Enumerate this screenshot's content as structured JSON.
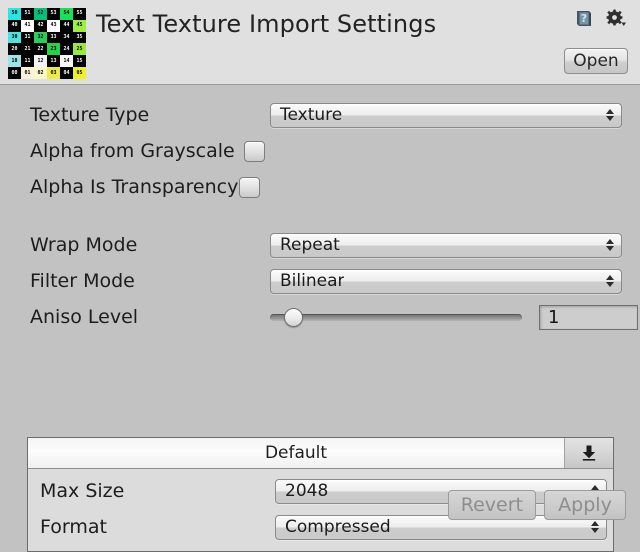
{
  "header": {
    "title": "Text Texture Import Settings",
    "help_icon": "help-book-icon",
    "gear_icon": "gear-icon",
    "open_label": "Open"
  },
  "texture_preview": {
    "name": "texture-thumbnail",
    "cells": [
      {
        "label": "50",
        "bg": "#26e6e6",
        "fg": "#000000"
      },
      {
        "label": "51",
        "bg": "#000000",
        "fg": "#ffffff"
      },
      {
        "label": "52",
        "bg": "#00c07a",
        "fg": "#000000"
      },
      {
        "label": "53",
        "bg": "#000000",
        "fg": "#ffffff"
      },
      {
        "label": "54",
        "bg": "#18e05a",
        "fg": "#000000"
      },
      {
        "label": "55",
        "bg": "#000000",
        "fg": "#ffffff"
      },
      {
        "label": "40",
        "bg": "#000000",
        "fg": "#ffffff"
      },
      {
        "label": "41",
        "bg": "#ffffff",
        "fg": "#000000"
      },
      {
        "label": "42",
        "bg": "#000000",
        "fg": "#ffffff"
      },
      {
        "label": "43",
        "bg": "#ffffff",
        "fg": "#000000"
      },
      {
        "label": "44",
        "bg": "#000000",
        "fg": "#ffffff"
      },
      {
        "label": "45",
        "bg": "#9cf03c",
        "fg": "#000000"
      },
      {
        "label": "30",
        "bg": "#4ae2e2",
        "fg": "#000000"
      },
      {
        "label": "31",
        "bg": "#000000",
        "fg": "#ffffff"
      },
      {
        "label": "32",
        "bg": "#28cf5e",
        "fg": "#000000"
      },
      {
        "label": "33",
        "bg": "#000000",
        "fg": "#ffffff"
      },
      {
        "label": "34",
        "bg": "#000000",
        "fg": "#ffffff"
      },
      {
        "label": "35",
        "bg": "#000000",
        "fg": "#ffffff"
      },
      {
        "label": "20",
        "bg": "#000000",
        "fg": "#ffffff"
      },
      {
        "label": "21",
        "bg": "#000000",
        "fg": "#ffffff"
      },
      {
        "label": "22",
        "bg": "#000000",
        "fg": "#ffffff"
      },
      {
        "label": "23",
        "bg": "#28d24a",
        "fg": "#000000"
      },
      {
        "label": "24",
        "bg": "#000000",
        "fg": "#ffffff"
      },
      {
        "label": "25",
        "bg": "#9ae83a",
        "fg": "#000000"
      },
      {
        "label": "10",
        "bg": "#9ae4ea",
        "fg": "#000000"
      },
      {
        "label": "11",
        "bg": "#000000",
        "fg": "#ffffff"
      },
      {
        "label": "12",
        "bg": "#f4f4f4",
        "fg": "#000000"
      },
      {
        "label": "13",
        "bg": "#000000",
        "fg": "#ffffff"
      },
      {
        "label": "14",
        "bg": "#f8f8f8",
        "fg": "#000000"
      },
      {
        "label": "15",
        "bg": "#000000",
        "fg": "#ffffff"
      },
      {
        "label": "00",
        "bg": "#000000",
        "fg": "#ffffff"
      },
      {
        "label": "01",
        "bg": "#f6f3d8",
        "fg": "#000000"
      },
      {
        "label": "02",
        "bg": "#faf7c8",
        "fg": "#000000"
      },
      {
        "label": "03",
        "bg": "#eeea46",
        "fg": "#000000"
      },
      {
        "label": "04",
        "bg": "#000000",
        "fg": "#ffffff"
      },
      {
        "label": "05",
        "bg": "#f2ef22",
        "fg": "#000000"
      }
    ]
  },
  "settings": {
    "texture_type": {
      "label": "Texture Type",
      "value": "Texture"
    },
    "alpha_from_grayscale": {
      "label": "Alpha from Grayscale",
      "checked": false
    },
    "alpha_is_transparency": {
      "label": "Alpha Is Transparency",
      "checked": false
    },
    "wrap_mode": {
      "label": "Wrap Mode",
      "value": "Repeat"
    },
    "filter_mode": {
      "label": "Filter Mode",
      "value": "Bilinear"
    },
    "aniso_level": {
      "label": "Aniso Level",
      "value": "1",
      "min": 0,
      "max": 16,
      "percent": 6
    }
  },
  "platform": {
    "tab_label": "Default",
    "download_icon": "download-arrow-icon",
    "max_size": {
      "label": "Max Size",
      "value": "2048"
    },
    "format": {
      "label": "Format",
      "value": "Compressed"
    }
  },
  "footer": {
    "revert_label": "Revert",
    "apply_label": "Apply"
  },
  "colors": {
    "header_bg": "#e0e0e0",
    "body_bg": "#c2c2c2",
    "text": "#1d1d1d",
    "disabled_text": "#8e8e8e"
  }
}
